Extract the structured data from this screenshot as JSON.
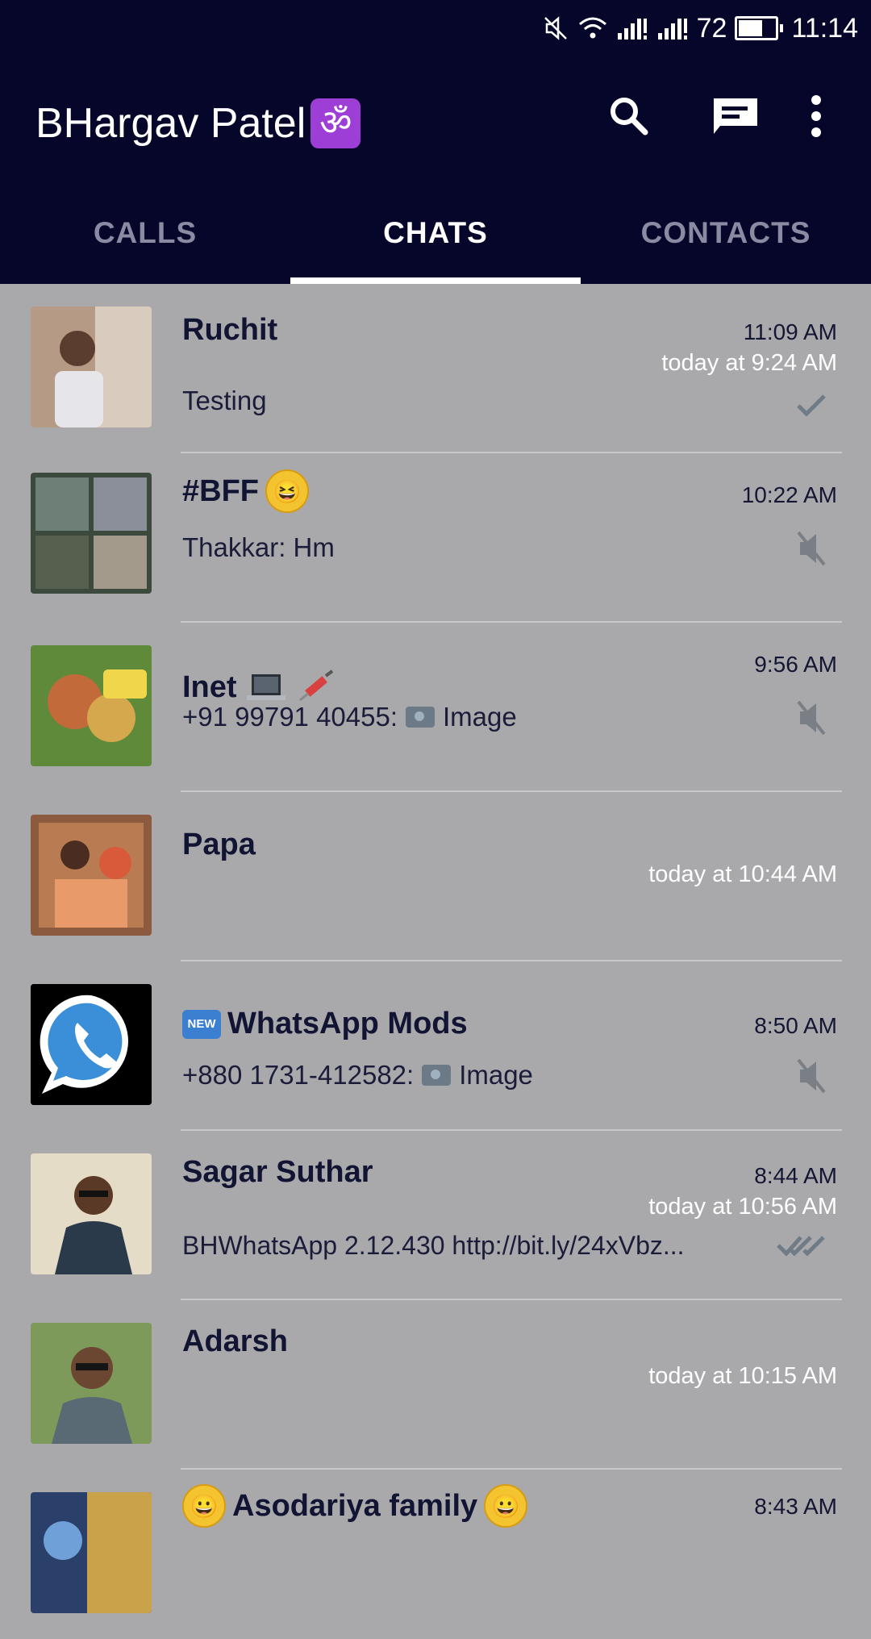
{
  "status_bar": {
    "battery": "72",
    "time": "11:14",
    "battery_level": 0.72
  },
  "header": {
    "title": "BHargav Patel",
    "badge": "ॐ"
  },
  "tabs": [
    {
      "label": "CALLS",
      "active": false
    },
    {
      "label": "CHATS",
      "active": true
    },
    {
      "label": "CONTACTS",
      "active": false
    }
  ],
  "colors": {
    "header_bg": "#05062a",
    "list_bg": "#a9a9ab",
    "badge_purple": "#9d3fd6"
  },
  "chats": [
    {
      "name": "Ruchit",
      "time": "11:09 AM",
      "seen": "today at 9:24 AM",
      "preview": "Testing",
      "status_icon": "single-check-icon"
    },
    {
      "name": "#BFF",
      "name_suffix_emoji": "😆",
      "time": "10:22 AM",
      "seen": "",
      "preview": "Thakkar:  Hm",
      "status_icon": "muted-icon"
    },
    {
      "name": "Inet",
      "time": "9:56 AM",
      "seen": "",
      "preview": "+91 99791 40455:",
      "preview_media": "Image",
      "status_icon": "muted-icon"
    },
    {
      "name": "Papa",
      "time": "",
      "seen": "today at 10:44 AM",
      "preview": "",
      "status_icon": ""
    },
    {
      "name": "WhatsApp Mods",
      "prefix_badge": "NEW",
      "time": "8:50 AM",
      "seen": "",
      "preview": "+880 1731-412582:",
      "preview_media": "Image",
      "status_icon": "muted-icon"
    },
    {
      "name": "Sagar Suthar",
      "time": "8:44 AM",
      "seen": "today at 10:56 AM",
      "preview": "BHWhatsApp 2.12.430  http://bit.ly/24xVbz...",
      "status_icon": "double-check-icon"
    },
    {
      "name": "Adarsh",
      "time": "",
      "seen": "today at 10:15 AM",
      "preview": "",
      "status_icon": ""
    },
    {
      "name": "Asodariya family",
      "time": "8:43 AM",
      "seen": "",
      "preview": "",
      "status_icon": ""
    }
  ]
}
